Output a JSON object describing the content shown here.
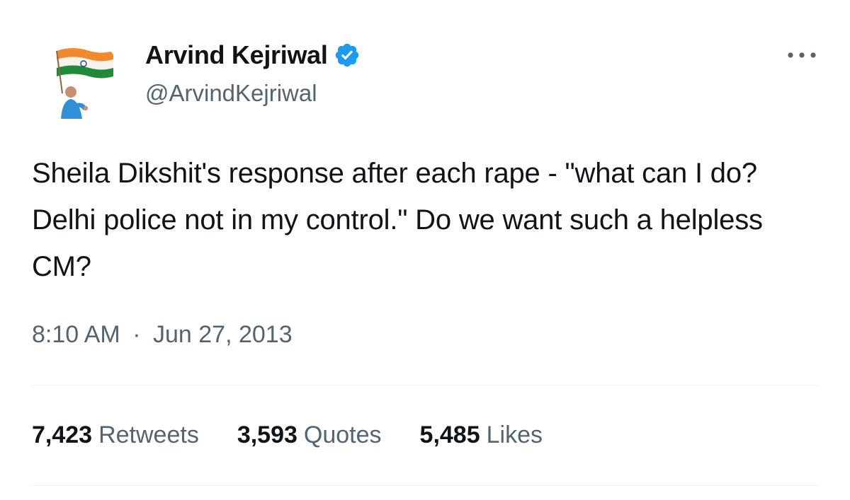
{
  "tweet": {
    "author": {
      "display_name": "Arvind Kejriwal",
      "handle": "@ArvindKejriwal",
      "verified": true,
      "verified_color": "#1d9bf0"
    },
    "text": "Sheila Dikshit's response after each rape - \"what can I do? Delhi police not in my control.\" Do we want such a helpless CM?",
    "time": "8:10 AM",
    "separator": "·",
    "date": "Jun 27, 2013",
    "stats": [
      {
        "count": "7,423",
        "label": "Retweets"
      },
      {
        "count": "3,593",
        "label": "Quotes"
      },
      {
        "count": "5,485",
        "label": "Likes"
      }
    ],
    "more_icon": "more-horizontal-icon"
  },
  "colors": {
    "primary_text": "#0f1419",
    "secondary_text": "#536471",
    "divider": "#eff3f4",
    "accent": "#1d9bf0"
  }
}
